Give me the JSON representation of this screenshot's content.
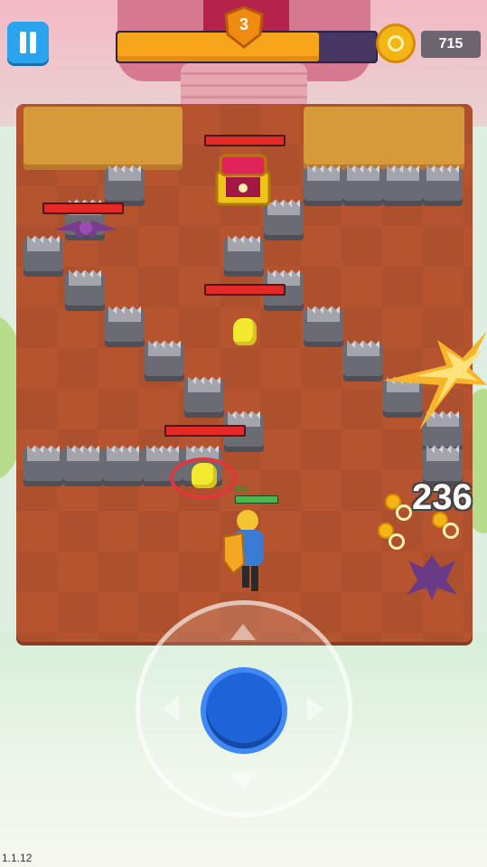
{
  "hud": {
    "level": "3",
    "xp_progress": 0.78,
    "coins": "715"
  },
  "combat": {
    "damage_number": "236",
    "hero_hp_text": "434"
  },
  "footer": {
    "version": "1.1.12"
  },
  "colors": {
    "board": "#b6542f",
    "xp_fill": "#f7a51a",
    "pause_button": "#2aa4ee",
    "joystick": "#1f63d9",
    "enemy_hp": "#e52927"
  },
  "icons": [
    "pause-icon",
    "level-shield-icon",
    "coin-icon",
    "treasure-chest-icon",
    "bat-icon",
    "slime-icon",
    "hero-icon",
    "joystick-arrow-icon"
  ]
}
